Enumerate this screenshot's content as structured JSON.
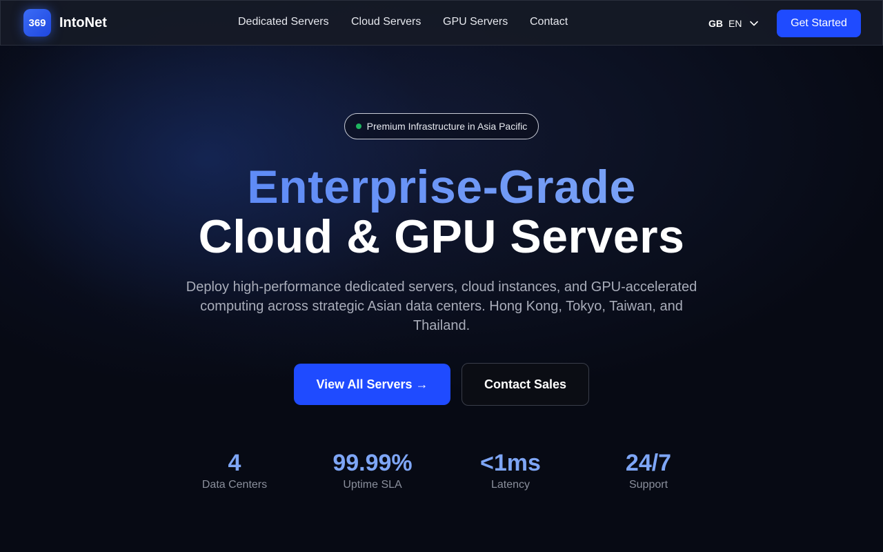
{
  "header": {
    "logo_text": "369",
    "brand": "IntoNet",
    "nav": [
      {
        "label": "Dedicated Servers"
      },
      {
        "label": "Cloud Servers"
      },
      {
        "label": "GPU Servers"
      },
      {
        "label": "Contact"
      }
    ],
    "language": {
      "flag": "GB",
      "code": "EN",
      "icon": "chevron-down-icon"
    },
    "cta_label": "Get Started"
  },
  "hero": {
    "badge": "Premium Infrastructure in Asia Pacific",
    "title_line1": "Enterprise-Grade",
    "title_line2": "Cloud & GPU Servers",
    "subtitle": "Deploy high-performance dedicated servers, cloud instances, and GPU-accelerated computing across strategic Asian data centers. Hong Kong, Tokyo, Taiwan, and Thailand.",
    "primary_button": "View All Servers →",
    "secondary_button": "Contact Sales"
  },
  "stats": [
    {
      "value": "4",
      "label": "Data Centers"
    },
    {
      "value": "99.99%",
      "label": "Uptime SLA"
    },
    {
      "value": "<1ms",
      "label": "Latency"
    },
    {
      "value": "24/7",
      "label": "Support"
    }
  ],
  "colors": {
    "accent": "#1f4bff",
    "stat_value": "#7ea6f6",
    "status_dot": "#1fb560",
    "background": "#070a14"
  }
}
